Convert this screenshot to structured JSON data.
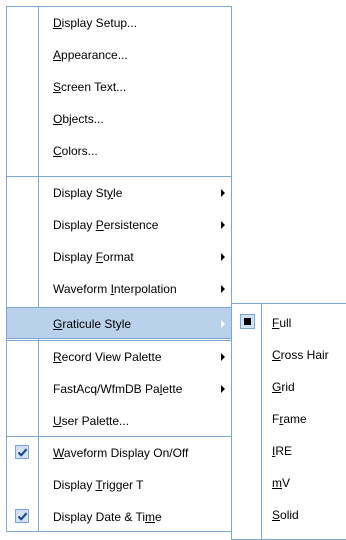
{
  "menu": {
    "items": [
      {
        "pre": "",
        "key": "D",
        "post": "isplay Setup...",
        "submenu": false,
        "checked": false
      },
      {
        "pre": "",
        "key": "A",
        "post": "ppearance...",
        "submenu": false,
        "checked": false
      },
      {
        "pre": "",
        "key": "S",
        "post": "creen Text...",
        "submenu": false,
        "checked": false
      },
      {
        "pre": "",
        "key": "O",
        "post": "bjects...",
        "submenu": false,
        "checked": false
      },
      {
        "pre": "",
        "key": "C",
        "post": "olors...",
        "submenu": false,
        "checked": false
      },
      {
        "pre": "Display St",
        "key": "y",
        "post": "le",
        "submenu": true,
        "checked": false
      },
      {
        "pre": "Display ",
        "key": "P",
        "post": "ersistence",
        "submenu": true,
        "checked": false
      },
      {
        "pre": "Display ",
        "key": "F",
        "post": "ormat",
        "submenu": true,
        "checked": false
      },
      {
        "pre": "Waveform ",
        "key": "I",
        "post": "nterpolation",
        "submenu": true,
        "checked": false
      },
      {
        "pre": "",
        "key": "G",
        "post": "raticule Style",
        "submenu": true,
        "checked": false,
        "highlighted": true
      },
      {
        "pre": "",
        "key": "R",
        "post": "ecord View Palette",
        "submenu": true,
        "checked": false
      },
      {
        "pre": "FastAcq/WfmDB Pa",
        "key": "l",
        "post": "ette",
        "submenu": true,
        "checked": false
      },
      {
        "pre": "",
        "key": "U",
        "post": "ser Palette...",
        "submenu": false,
        "checked": false
      },
      {
        "pre": "",
        "key": "W",
        "post": "aveform Display On/Off",
        "submenu": false,
        "checked": true
      },
      {
        "pre": "Display ",
        "key": "T",
        "post": "rigger T",
        "submenu": false,
        "checked": false
      },
      {
        "pre": "Display Date & Ti",
        "key": "m",
        "post": "e",
        "submenu": false,
        "checked": true
      }
    ]
  },
  "submenu": {
    "items": [
      {
        "pre": "",
        "key": "F",
        "post": "ull",
        "selected": true
      },
      {
        "pre": "",
        "key": "C",
        "post": "ross Hair",
        "selected": false
      },
      {
        "pre": "",
        "key": "G",
        "post": "rid",
        "selected": false
      },
      {
        "pre": "F",
        "key": "r",
        "post": "ame",
        "selected": false
      },
      {
        "pre": "",
        "key": "I",
        "post": "RE",
        "selected": false
      },
      {
        "pre": "",
        "key": "m",
        "post": "V",
        "selected": false
      },
      {
        "pre": "",
        "key": "S",
        "post": "olid",
        "selected": false
      }
    ]
  }
}
